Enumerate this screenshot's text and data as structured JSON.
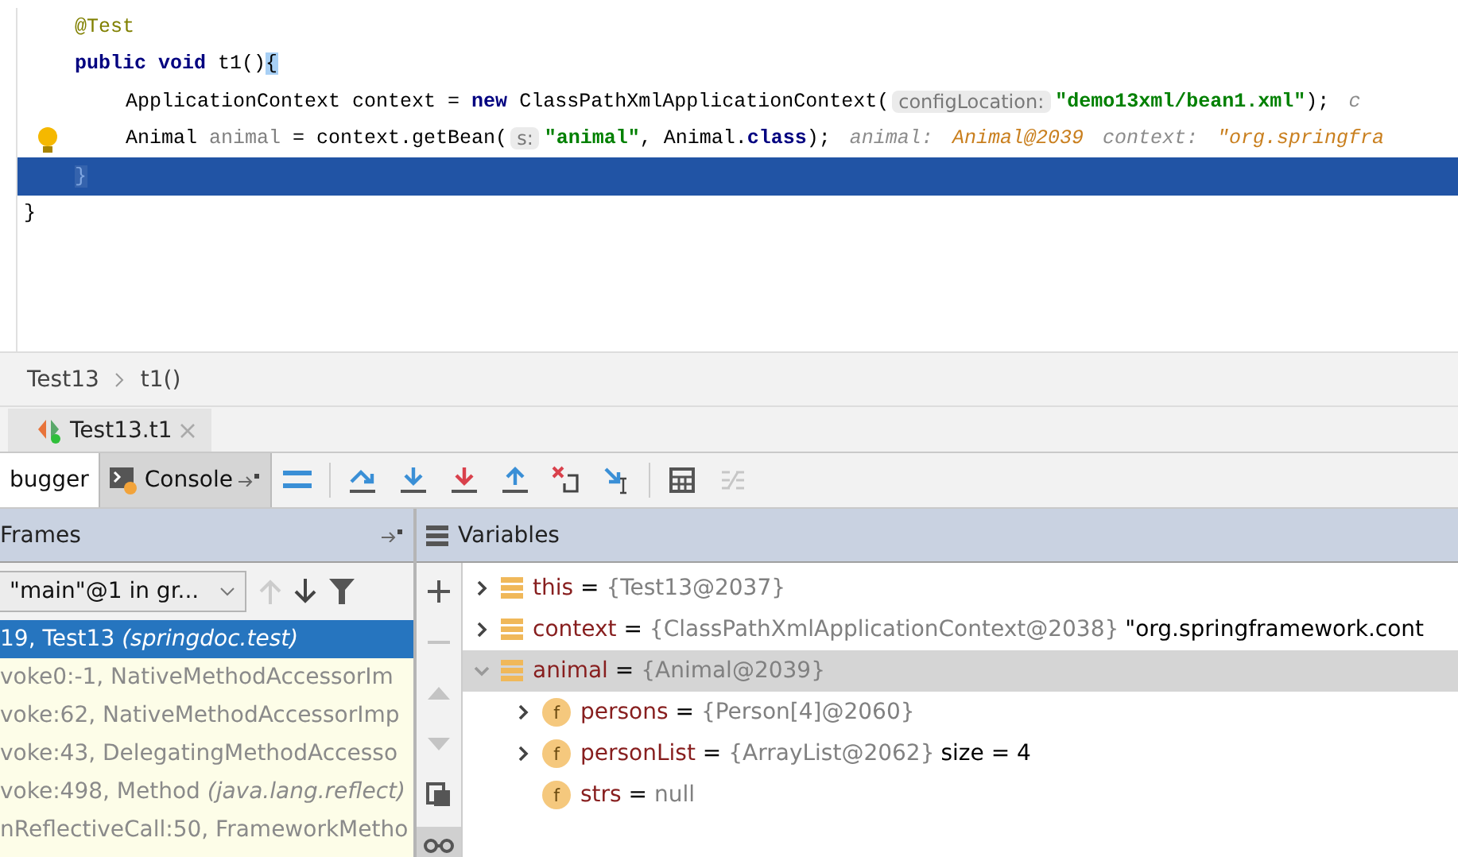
{
  "editor": {
    "class_body": [
      {
        "current": false,
        "bulb": false,
        "tokens": [
          {
            "kind": "annotation",
            "text": "@Test"
          }
        ]
      },
      {
        "current": false,
        "bulb": false,
        "tokens": [
          {
            "kind": "keyword",
            "text": "public void"
          },
          {
            "kind": "plain",
            "text": " t1()"
          },
          {
            "kind": "brace",
            "text": "{"
          }
        ],
        "children": [
          {
            "current": false,
            "bulb": false,
            "tokens": [
              {
                "kind": "plain",
                "text": "ApplicationContext context = "
              },
              {
                "kind": "keyword",
                "text": "new"
              },
              {
                "kind": "plain",
                "text": " ClassPathXmlApplicationContext("
              },
              {
                "kind": "hint",
                "text": "configLocation:"
              },
              {
                "kind": "string",
                "text": "\"demo13xml/bean1.xml\""
              },
              {
                "kind": "plain",
                "text": ");"
              },
              {
                "kind": "inlay",
                "text": "c"
              }
            ]
          },
          {
            "current": false,
            "bulb": true,
            "tokens": [
              {
                "kind": "plain",
                "text": "Animal "
              },
              {
                "kind": "local",
                "text": "animal"
              },
              {
                "kind": "plain",
                "text": " = context.getBean("
              },
              {
                "kind": "hint",
                "text": "s:"
              },
              {
                "kind": "string",
                "text": "\"animal\""
              },
              {
                "kind": "plain",
                "text": ", Animal."
              },
              {
                "kind": "keyword",
                "text": "class"
              },
              {
                "kind": "plain",
                "text": ");"
              },
              {
                "kind": "inlay",
                "text": "animal:"
              },
              {
                "kind": "inlay-value",
                "text": "Animal@2039"
              },
              {
                "kind": "inlay",
                "text": "context:"
              },
              {
                "kind": "inlay-value",
                "text": "\"org.springfra"
              }
            ]
          }
        ]
      },
      {
        "current": true,
        "bulb": false,
        "tokens": [
          {
            "kind": "brace",
            "text": "}"
          }
        ]
      }
    ],
    "class_end": {
      "current": false,
      "bulb": false,
      "tokens": [
        {
          "kind": "plain",
          "text": "}"
        }
      ]
    }
  },
  "breadcrumb": [
    "Test13",
    "t1()"
  ],
  "run_tab": {
    "label": "Test13.t1"
  },
  "debug_tabs": [
    {
      "label": "bugger",
      "selected": true,
      "kind": "debugger"
    },
    {
      "label": "Console",
      "selected": false,
      "kind": "console"
    }
  ],
  "toolbar": [
    {
      "kind": "layout",
      "disabled": false
    },
    {
      "kind": "step-over",
      "disabled": false
    },
    {
      "kind": "step-into",
      "disabled": false
    },
    {
      "kind": "force-step-into",
      "disabled": false
    },
    {
      "kind": "step-out",
      "disabled": false
    },
    {
      "kind": "drop-frame",
      "disabled": false
    },
    {
      "kind": "run-to-cursor",
      "disabled": false
    },
    {
      "kind": "evaluate",
      "disabled": false
    },
    {
      "kind": "trace",
      "disabled": true
    }
  ],
  "frames": {
    "title": "Frames",
    "thread": "\"main\"@1 in gr...",
    "rows": [
      {
        "text": "19, Test13 *(springdoc.test)*",
        "selected": true
      },
      {
        "text": "voke0:-1, NativeMethodAccessorIm",
        "selected": false
      },
      {
        "text": "voke:62, NativeMethodAccessorImp",
        "selected": false
      },
      {
        "text": "voke:43, DelegatingMethodAccesso",
        "selected": false
      },
      {
        "text": "voke:498, Method *(java.lang.reflect)*",
        "selected": false
      },
      {
        "text": "nReflectiveCall:50, FrameworkMetho",
        "selected": false
      }
    ]
  },
  "variables": {
    "title": "Variables",
    "side_tools": [
      {
        "kind": "add",
        "disabled": false,
        "selected": false
      },
      {
        "kind": "remove",
        "disabled": true,
        "selected": false
      },
      {
        "kind": "up",
        "disabled": true,
        "selected": false
      },
      {
        "kind": "down",
        "disabled": true,
        "selected": false
      },
      {
        "kind": "copy",
        "disabled": false,
        "selected": false
      },
      {
        "kind": "glasses",
        "disabled": false,
        "selected": true
      }
    ],
    "items": [
      {
        "kind": "local",
        "name": "this",
        "sign": "=",
        "value": "{Test13@2037}",
        "expandable": true,
        "expanded": false,
        "selected": false
      },
      {
        "kind": "local",
        "name": "context",
        "sign": "=",
        "value": "{ClassPathXmlApplicationContext@2038}",
        "extra": "\"org.springframework.cont",
        "expandable": true,
        "expanded": false,
        "selected": false
      },
      {
        "kind": "local",
        "name": "animal",
        "sign": "=",
        "value": "{Animal@2039}",
        "expandable": true,
        "expanded": true,
        "selected": true,
        "children": [
          {
            "kind": "field",
            "badge": "f",
            "name": "persons",
            "sign": "=",
            "value": "{Person[4]@2060}",
            "expandable": true,
            "expanded": false,
            "selected": false
          },
          {
            "kind": "field",
            "badge": "f",
            "name": "personList",
            "sign": "=",
            "value": "{ArrayList@2062}",
            "extra": "size = 4",
            "expandable": true,
            "expanded": false,
            "selected": false
          },
          {
            "kind": "field",
            "badge": "f",
            "name": "strs",
            "sign": "=",
            "value": "null",
            "expandable": false,
            "expanded": false,
            "selected": false
          }
        ]
      }
    ]
  }
}
